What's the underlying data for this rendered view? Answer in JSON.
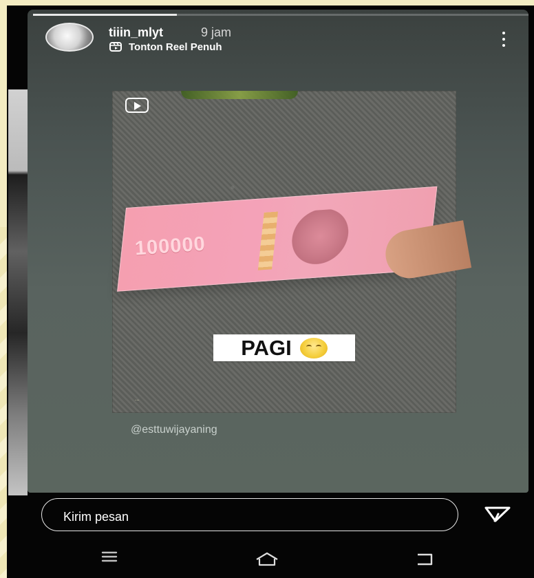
{
  "header": {
    "username": "tiiin_mlyt",
    "time": "9 jam",
    "reel_label": "Tonton Reel Penuh"
  },
  "media": {
    "banknote_value": "100000",
    "sticker_text": "PAGI",
    "caption_small": "...",
    "mention": "@esttuwijayaning"
  },
  "message_bar": {
    "placeholder": "Kirim pesan"
  },
  "icons": {
    "more": "more-vertical-icon",
    "reel": "reel-icon",
    "send": "send-icon",
    "menu": "menu-icon",
    "home": "home-icon",
    "back": "back-icon"
  },
  "progress": 0.29
}
